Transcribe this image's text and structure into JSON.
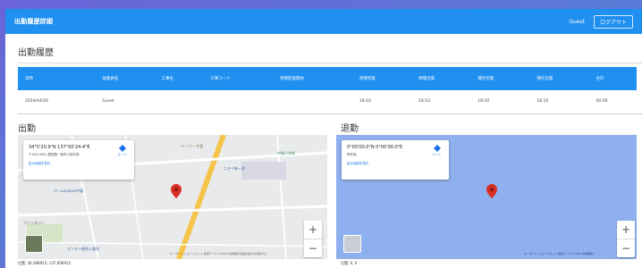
{
  "header": {
    "title": "出勤履歴詳細",
    "user": "Guest",
    "logout_label": "ログアウト"
  },
  "history": {
    "title": "出勤履歴",
    "columns": [
      "日時",
      "従業員名",
      "工事名",
      "工事コード",
      "現場回送開始",
      "現場到着",
      "現場出発",
      "帰社到着",
      "帰社出発",
      "合計"
    ],
    "rows": [
      [
        "2024/04/26",
        "Guest",
        "",
        "",
        "",
        "18:10",
        "18:10",
        "18:10",
        "18:10",
        "00:00"
      ]
    ]
  },
  "clock_in": {
    "title": "出勤",
    "coords": "34°5'20.9\"N 137°00'24.4\"E",
    "address": "〒494-0001 愛知県一宮市小信中島",
    "link": "拡大地図を表示",
    "route_label": "ルート",
    "below_text": "位置: 34.088913, 137.006913",
    "attribution": "キーボード ショートカット  地図データ ©2024  利用規約  地図の誤りを報告する",
    "map_labels": [
      "テンワー 中島",
      "中島小学校",
      "ニチイ新一宮",
      "ホームLupros中島",
      "ファンタジー",
      "デンキー総合入場所"
    ]
  },
  "clock_out": {
    "title": "退勤",
    "coords": "0°00'00.0\"N 0°00'00.0\"E",
    "address": "所在地",
    "link": "拡大地図を表示",
    "route_label": "ルート",
    "below_text": "位置: 0, 0",
    "attribution": "キーボード ショートカット  地図データ ©2024  利用規約"
  },
  "colors": {
    "header": "#1f8ff0",
    "marker": "#d93025",
    "ocean": "#8fb0ee"
  }
}
